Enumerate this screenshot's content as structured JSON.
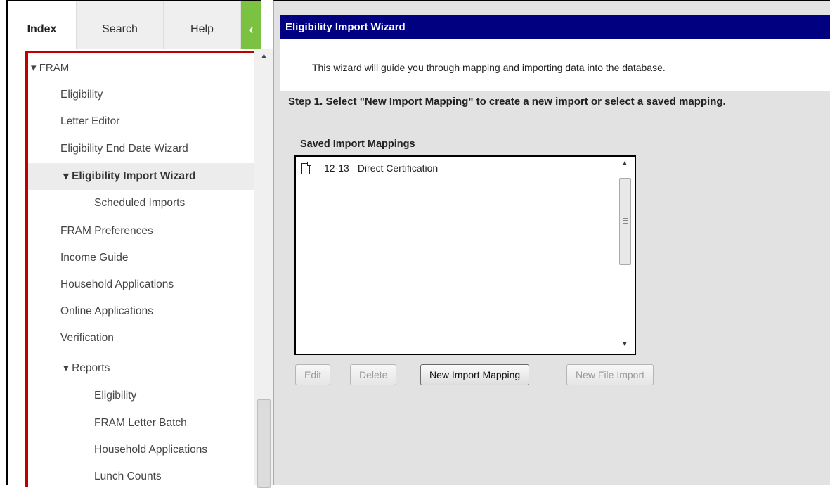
{
  "nav_tabs": {
    "index": "Index",
    "search": "Search",
    "help": "Help",
    "collapse_glyph": "‹"
  },
  "tree": {
    "root": "▾ FRAM",
    "items": [
      "Eligibility",
      "Letter Editor",
      "Eligibility End Date Wizard",
      "▾ Eligibility Import Wizard",
      "Scheduled Imports",
      "FRAM Preferences",
      "Income Guide",
      "Household Applications",
      "Online Applications",
      "Verification",
      "▾ Reports",
      "Eligibility",
      "FRAM Letter Batch",
      "Household Applications",
      "Lunch Counts"
    ],
    "selected_index": 3
  },
  "wizard": {
    "title": "Eligibility Import Wizard",
    "intro": "This wizard will guide you through mapping and importing data into the database.",
    "step": "Step 1. Select \"New Import Mapping\" to create a new import or select a saved mapping.",
    "saved_label": "Saved Import Mappings",
    "saved_mappings": [
      {
        "year": "12-13",
        "name": "Direct Certification"
      }
    ]
  },
  "buttons": {
    "edit": "Edit",
    "delete": "Delete",
    "new_import_mapping": "New Import Mapping",
    "new_file_import": "New File Import"
  },
  "colors": {
    "title_bar": "#000080",
    "accent_green": "#7cc242",
    "highlight_border": "#c00000"
  },
  "icons": {
    "up_arrow": "▲",
    "down_arrow": "▼"
  }
}
